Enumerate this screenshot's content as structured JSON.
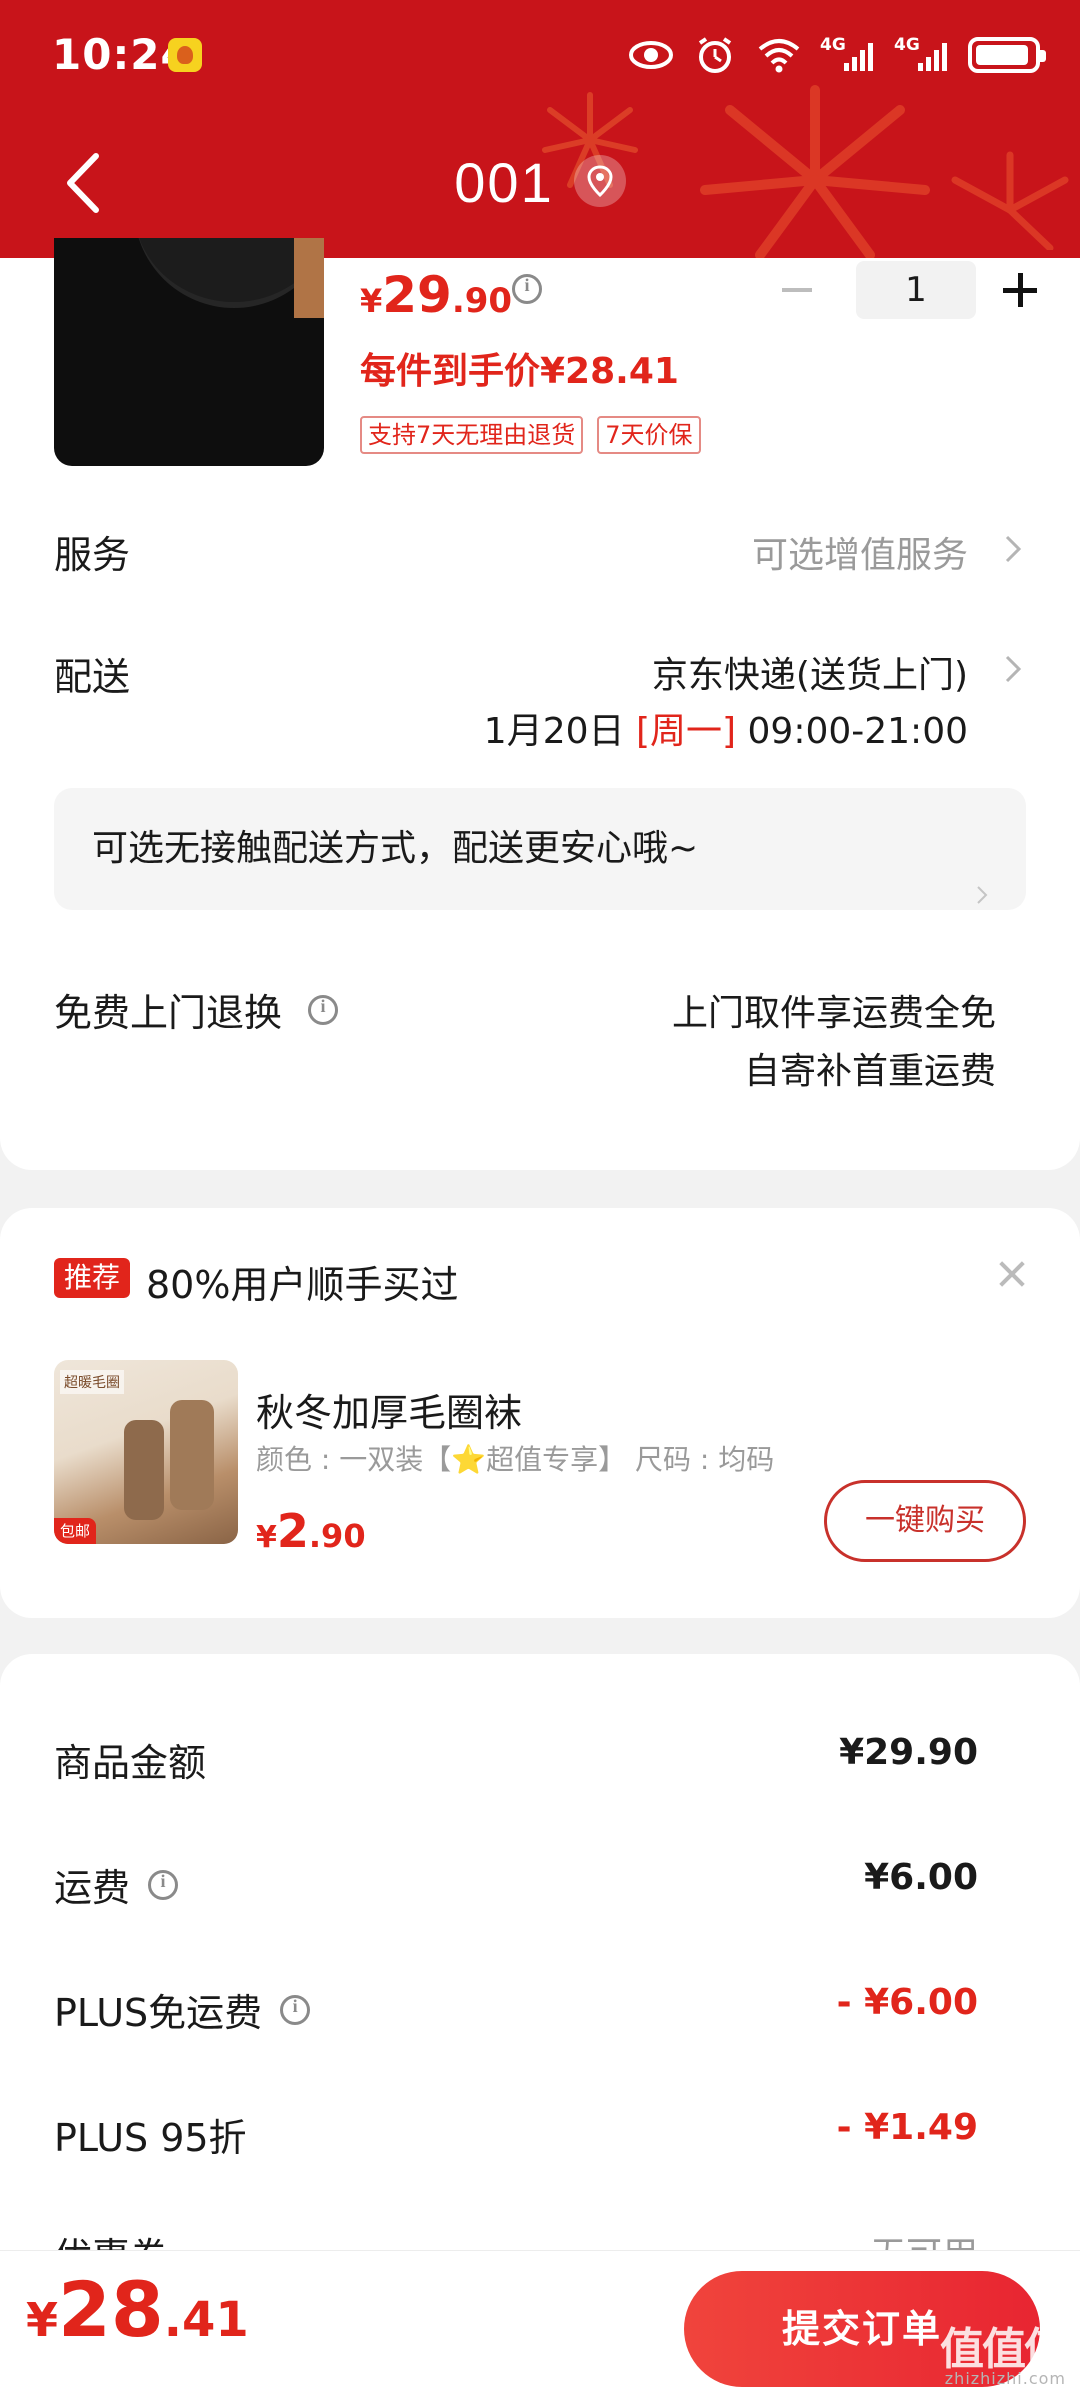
{
  "status_bar": {
    "time": "10:24",
    "network_1": "4G",
    "network_2": "4G",
    "icons": [
      "eye-icon",
      "alarm-icon",
      "wifi-icon",
      "signal-icon",
      "signal-icon",
      "battery-icon"
    ]
  },
  "nav": {
    "title": "001",
    "back_icon": "chevron-left-icon",
    "location_icon": "location-pin-icon",
    "background_color": "#c8141a"
  },
  "product": {
    "price_currency": "¥",
    "price_int": "29",
    "price_dec": ".90",
    "per_item_price": "每件到手价¥28.41",
    "tags": [
      "支持7天无理由退货",
      "7天价保"
    ],
    "quantity": "1"
  },
  "service": {
    "label": "服务",
    "value": "可选增值服务"
  },
  "delivery": {
    "label": "配送",
    "method": "京东快递(送货上门)",
    "date": "1月20日",
    "weekday": "[周一]",
    "time_window": "09:00-21:00",
    "contactless_text": "可选无接触配送方式，配送更安心哦~"
  },
  "return": {
    "label": "免费上门退换",
    "line1": "上门取件享运费全免",
    "line2": "自寄补首重运费"
  },
  "recommend": {
    "badge": "推荐",
    "title": "80%用户顺手买过",
    "image_label": "超暖毛圈",
    "image_badge": "包邮",
    "item_name": "秋冬加厚毛圈袜",
    "item_spec": "颜色 : 一双装【⭐超值专享】   尺码 : 均码",
    "price_currency": "¥",
    "price_int": "2",
    "price_dec": ".90",
    "buy_button": "一键购买"
  },
  "summary": {
    "rows": [
      {
        "label": "商品金额",
        "value": "¥29.90",
        "info": false,
        "red": false
      },
      {
        "label": "运费",
        "value": "¥6.00",
        "info": true,
        "red": false
      },
      {
        "label": "PLUS免运费",
        "value": "- ¥6.00",
        "info": true,
        "red": true
      },
      {
        "label": "PLUS 95折",
        "value": "- ¥1.49",
        "info": false,
        "red": true
      },
      {
        "label": "优惠券",
        "value": "无可用",
        "info": false,
        "red": false
      }
    ]
  },
  "bottom": {
    "total_currency": "¥",
    "total_int": "28",
    "total_dec": ".41",
    "submit_label": "提交订单",
    "watermark": "值值值",
    "watermark_sub": "zhizhizhi.com"
  },
  "colors": {
    "accent": "#e1251b",
    "header": "#c8141a"
  }
}
